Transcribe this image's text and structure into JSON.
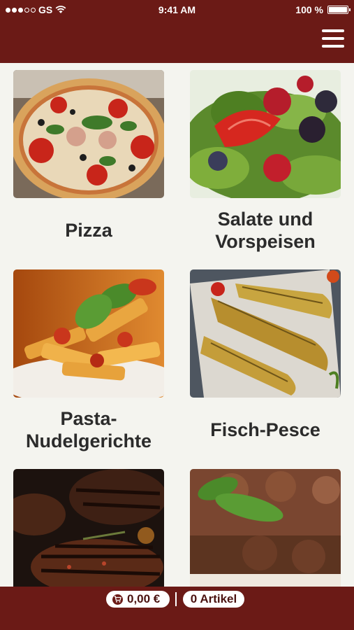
{
  "statusbar": {
    "carrier": "GS",
    "time": "9:41 AM",
    "battery": "100 %"
  },
  "menu": {
    "icon": "hamburger-menu-icon"
  },
  "categories": [
    {
      "label": "Pizza"
    },
    {
      "label": "Salate und Vorspeisen"
    },
    {
      "label": "Pasta-Nudelgerichte"
    },
    {
      "label": "Fisch-Pesce"
    },
    {
      "label": "",
      "image": "grilled-steak"
    },
    {
      "label": "",
      "image": "chocolate-dessert"
    }
  ],
  "cart": {
    "price": "0,00 €",
    "items": "0 Artikel",
    "icon": "cart-icon"
  },
  "colors": {
    "brand": "#6b1a16",
    "background": "#f4f4ef",
    "text": "#2b2b2b"
  }
}
